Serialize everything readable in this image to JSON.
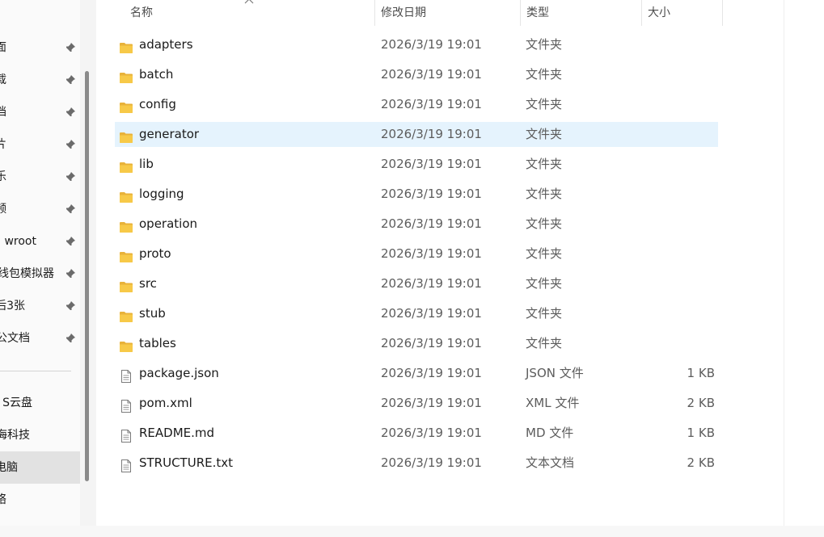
{
  "navigation": {
    "quick_access": [
      {
        "label": "面",
        "pinned": true
      },
      {
        "label": "载",
        "pinned": true
      },
      {
        "label": "档",
        "pinned": true
      },
      {
        "label": "片",
        "pinned": true
      },
      {
        "label": "乐",
        "pinned": true
      },
      {
        "label": "频",
        "pinned": true
      },
      {
        "label": "wroot",
        "pinned": true
      },
      {
        "label": "线包模拟器",
        "pinned": true
      },
      {
        "label": "后3张",
        "pinned": true
      },
      {
        "label": "公文档",
        "pinned": true
      }
    ],
    "locations": [
      {
        "label": "S云盘",
        "selected": false
      },
      {
        "label": "海科技",
        "selected": false
      },
      {
        "label": "电脑",
        "selected": true
      },
      {
        "label": "络",
        "selected": false
      }
    ]
  },
  "columns": {
    "name": "名称",
    "modified": "修改日期",
    "type": "类型",
    "size": "大小"
  },
  "files": [
    {
      "name": "adapters",
      "modified": "2026/3/19 19:01",
      "type": "文件夹",
      "size": "",
      "icon": "folder-icon"
    },
    {
      "name": "batch",
      "modified": "2026/3/19 19:01",
      "type": "文件夹",
      "size": "",
      "icon": "folder-icon"
    },
    {
      "name": "config",
      "modified": "2026/3/19 19:01",
      "type": "文件夹",
      "size": "",
      "icon": "folder-icon"
    },
    {
      "name": "generator",
      "modified": "2026/3/19 19:01",
      "type": "文件夹",
      "size": "",
      "icon": "folder-icon",
      "selected": true
    },
    {
      "name": "lib",
      "modified": "2026/3/19 19:01",
      "type": "文件夹",
      "size": "",
      "icon": "folder-icon"
    },
    {
      "name": "logging",
      "modified": "2026/3/19 19:01",
      "type": "文件夹",
      "size": "",
      "icon": "folder-icon"
    },
    {
      "name": "operation",
      "modified": "2026/3/19 19:01",
      "type": "文件夹",
      "size": "",
      "icon": "folder-icon"
    },
    {
      "name": "proto",
      "modified": "2026/3/19 19:01",
      "type": "文件夹",
      "size": "",
      "icon": "folder-icon"
    },
    {
      "name": "src",
      "modified": "2026/3/19 19:01",
      "type": "文件夹",
      "size": "",
      "icon": "folder-icon"
    },
    {
      "name": "stub",
      "modified": "2026/3/19 19:01",
      "type": "文件夹",
      "size": "",
      "icon": "folder-icon"
    },
    {
      "name": "tables",
      "modified": "2026/3/19 19:01",
      "type": "文件夹",
      "size": "",
      "icon": "folder-icon"
    },
    {
      "name": "package.json",
      "modified": "2026/3/19 19:01",
      "type": "JSON 文件",
      "size": "1 KB",
      "icon": "file-icon"
    },
    {
      "name": "pom.xml",
      "modified": "2026/3/19 19:01",
      "type": "XML 文件",
      "size": "2 KB",
      "icon": "file-icon"
    },
    {
      "name": "README.md",
      "modified": "2026/3/19 19:01",
      "type": "MD 文件",
      "size": "1 KB",
      "icon": "file-icon"
    },
    {
      "name": "STRUCTURE.txt",
      "modified": "2026/3/19 19:01",
      "type": "文本文档",
      "size": "2 KB",
      "icon": "file-icon"
    }
  ],
  "colors": {
    "selection": "#e5f3fd",
    "folder": "#f7c948",
    "nav_selected": "#e2e2e2"
  }
}
